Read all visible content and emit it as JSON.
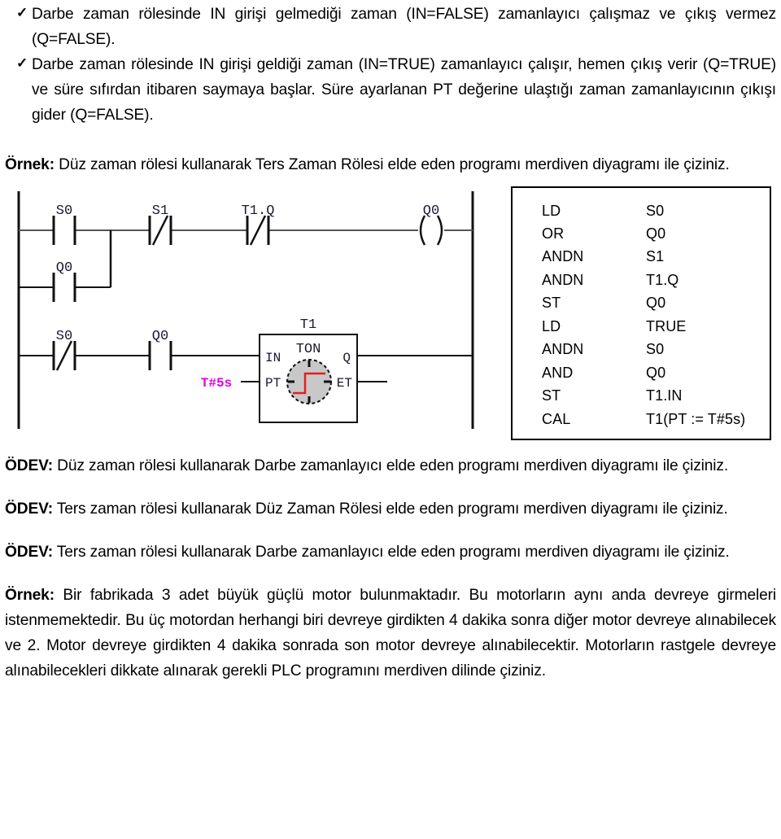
{
  "document": {
    "language": "tr",
    "bullet_glyph": "✓"
  },
  "bullets": [
    {
      "id": "bullet-in-false",
      "text": "Darbe zaman rölesinde IN girişi gelmediği zaman (IN=FALSE) zamanlayıcı çalışmaz ve çıkış vermez (Q=FALSE)."
    },
    {
      "id": "bullet-in-true",
      "text": "Darbe zaman rölesinde IN girişi geldiği zaman (IN=TRUE) zamanlayıcı çalışır, hemen çıkış verir (Q=TRUE) ve süre sıfırdan itibaren saymaya başlar. Süre ayarlanan PT değerine ulaştığı zaman zamanlayıcının çıkışı gider (Q=FALSE)."
    }
  ],
  "example_1": {
    "label": "Örnek:",
    "text": " Düz zaman rölesi kullanarak Ters Zaman Rölesi elde eden programı merdiven diyagramı ile çiziniz."
  },
  "ladder": {
    "rung1": {
      "contacts": [
        {
          "name": "S0",
          "type": "NO"
        },
        {
          "name": "S1",
          "type": "NC"
        },
        {
          "name": "T1.Q",
          "type": "NC"
        }
      ],
      "branch_contact": {
        "name": "Q0",
        "type": "NO"
      },
      "coil": {
        "name": "Q0",
        "type": "coil"
      }
    },
    "rung2": {
      "contacts": [
        {
          "name": "S0",
          "type": "NC"
        },
        {
          "name": "Q0",
          "type": "NO"
        }
      ],
      "block": {
        "instance": "T1",
        "type": "TON",
        "inputs": [
          "IN",
          "PT"
        ],
        "outputs": [
          "Q",
          "ET"
        ],
        "pt_value": "T#5s",
        "pt_value_color": "#e000e0",
        "icon": "clock-step-icon"
      }
    }
  },
  "code_block": {
    "lines": [
      {
        "op": "LD",
        "arg": "S0"
      },
      {
        "op": "OR",
        "arg": "Q0"
      },
      {
        "op": "ANDN",
        "arg": "S1"
      },
      {
        "op": "ANDN",
        "arg": "T1.Q"
      },
      {
        "op": "ST",
        "arg": "Q0"
      },
      {
        "op": "LD",
        "arg": "TRUE"
      },
      {
        "op": "ANDN",
        "arg": "S0"
      },
      {
        "op": "AND",
        "arg": "Q0"
      },
      {
        "op": "ST",
        "arg": "T1.IN"
      },
      {
        "op": "CAL",
        "arg": "T1(PT := T#5s)"
      }
    ]
  },
  "homework": [
    {
      "label": "ÖDEV:",
      "text": " Düz zaman rölesi kullanarak Darbe zamanlayıcı elde eden programı merdiven diyagramı ile çiziniz."
    },
    {
      "label": "ÖDEV:",
      "text": " Ters zaman rölesi kullanarak Düz Zaman Rölesi elde eden programı merdiven diyagramı ile çiziniz."
    },
    {
      "label": "ÖDEV:",
      "text": " Ters zaman rölesi kullanarak Darbe zamanlayıcı elde eden programı merdiven diyagramı ile çiziniz."
    }
  ],
  "example_2": {
    "label": "Örnek:",
    "text": " Bir fabrikada 3 adet büyük güçlü motor bulunmaktadır. Bu motorların aynı anda devreye girmeleri istenmemektedir. Bu üç motordan herhangi biri devreye girdikten 4 dakika sonra diğer motor devreye alınabilecek ve 2. Motor devreye girdikten 4 dakika sonrada son motor devreye alınabilecektir. Motorların rastgele devreye alınabilecekleri dikkate alınarak gerekli PLC programını merdiven dilinde çiziniz."
  }
}
